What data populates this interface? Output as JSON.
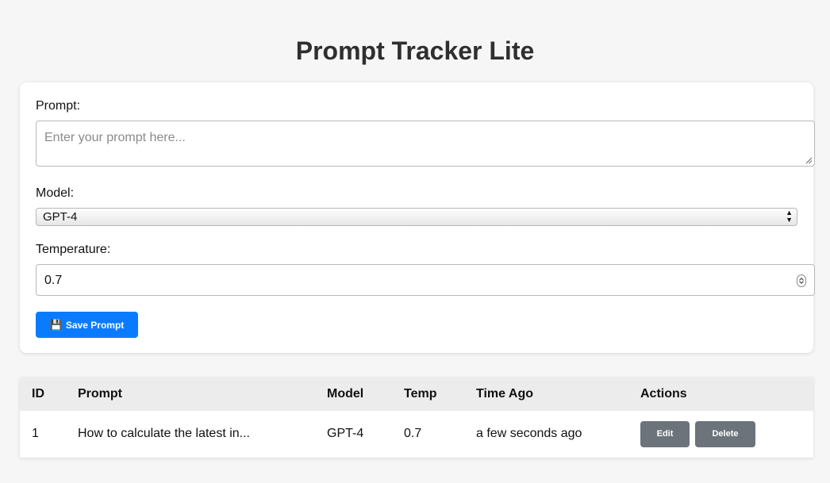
{
  "page": {
    "title": "Prompt Tracker Lite"
  },
  "form": {
    "prompt_label": "Prompt:",
    "prompt_placeholder": "Enter your prompt here...",
    "prompt_value": "",
    "model_label": "Model:",
    "model_selected": "GPT-4",
    "temperature_label": "Temperature:",
    "temperature_value": "0.7",
    "save_icon": "floppy-disk-icon",
    "save_glyph": "💾",
    "save_label": "Save Prompt"
  },
  "table": {
    "headers": [
      "ID",
      "Prompt",
      "Model",
      "Temp",
      "Time Ago",
      "Actions"
    ],
    "rows": [
      {
        "id": "1",
        "prompt": "How to calculate the latest in...",
        "model": "GPT-4",
        "temp": "0.7",
        "time_ago": "a few seconds ago",
        "edit_label": "Edit",
        "delete_label": "Delete"
      }
    ]
  },
  "colors": {
    "primary": "#0a7bff",
    "secondary": "#6c737a",
    "background": "#f6f6f6",
    "table_header": "#ececec"
  }
}
